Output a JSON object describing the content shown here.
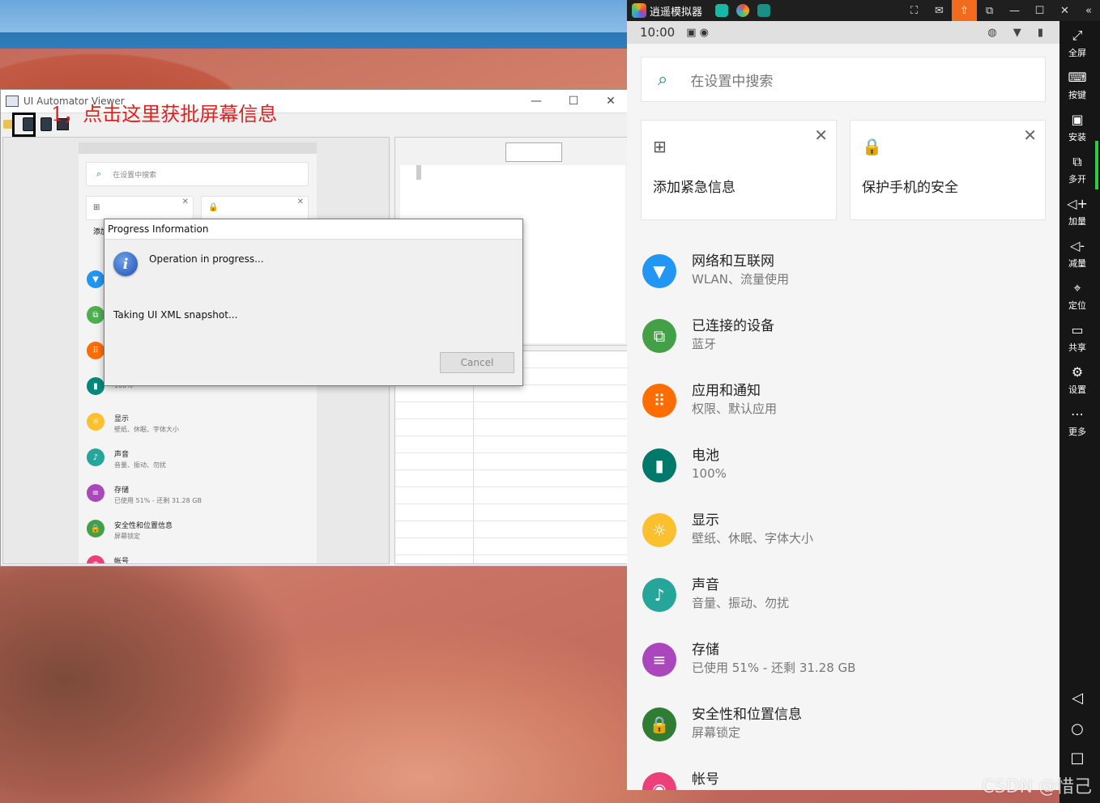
{
  "uiautomator": {
    "title": "UI Automator Viewer",
    "annotation": "1，点击这里获批屏幕信息",
    "win_min": "—",
    "win_max": "☐",
    "win_close": "✕",
    "mini": {
      "search_placeholder": "在设置中搜索",
      "card1_text": "添加",
      "items": [
        {
          "t1": "",
          "t2": "",
          "color": "#2196f3",
          "icon": "▼"
        },
        {
          "t1": "",
          "t2": "",
          "color": "#4caf50",
          "icon": "⧉"
        },
        {
          "t1": "",
          "t2": "",
          "color": "#ff6d00",
          "icon": "⠿"
        },
        {
          "t1": "",
          "t2": "100%",
          "color": "#00897b",
          "icon": "▮"
        },
        {
          "t1": "显示",
          "t2": "壁纸、休眠、字体大小",
          "color": "#fbc02d",
          "icon": "☼"
        },
        {
          "t1": "声音",
          "t2": "音量、振动、勿扰",
          "color": "#26a69a",
          "icon": "🔈"
        },
        {
          "t1": "存储",
          "t2": "已使用 51% - 还剩 31.28 GB",
          "color": "#ab47bc",
          "icon": "≡"
        },
        {
          "t1": "安全性和位置信息",
          "t2": "屏幕锁定",
          "color": "#43a047",
          "icon": "🔒"
        },
        {
          "t1": "帐号",
          "t2": "",
          "color": "#ec407a",
          "icon": "◉"
        }
      ]
    }
  },
  "dialog": {
    "title": "Progress Information",
    "message": "Operation in progress...",
    "status": "Taking UI XML snapshot...",
    "cancel_label": "Cancel",
    "info_glyph": "i"
  },
  "emulator": {
    "app_name": "逍遥模拟器",
    "status_time": "10:00",
    "status_icons": "◍ ▼ ▮",
    "search_placeholder": "在设置中搜索",
    "cards": [
      {
        "text": "添加紧急信息",
        "icon": "⊞",
        "close": "✕"
      },
      {
        "text": "保护手机的安全",
        "icon": "🔒",
        "close": "✕"
      }
    ],
    "items": [
      {
        "t1": "网络和互联网",
        "t2": "WLAN、流量使用",
        "color": "#2196f3",
        "icon": "▼"
      },
      {
        "t1": "已连接的设备",
        "t2": "蓝牙",
        "color": "#43a047",
        "icon": "⧉"
      },
      {
        "t1": "应用和通知",
        "t2": "权限、默认应用",
        "color": "#ff6d00",
        "icon": "⠿"
      },
      {
        "t1": "电池",
        "t2": "100%",
        "color": "#00796b",
        "icon": "▮"
      },
      {
        "t1": "显示",
        "t2": "壁纸、休眠、字体大小",
        "color": "#fbc02d",
        "icon": "☼"
      },
      {
        "t1": "声音",
        "t2": "音量、振动、勿扰",
        "color": "#26a69a",
        "icon": "🔈"
      },
      {
        "t1": "存储",
        "t2": "已使用 51% - 还剩 31.28 GB",
        "color": "#ab47bc",
        "icon": "≡"
      },
      {
        "t1": "安全性和位置信息",
        "t2": "屏幕锁定",
        "color": "#2e7d32",
        "icon": "🔒"
      },
      {
        "t1": "帐号",
        "t2": "",
        "color": "#ec407a",
        "icon": "◉"
      }
    ],
    "sidebar": [
      {
        "glyph": "⤢",
        "label": "全屏"
      },
      {
        "glyph": "⌨",
        "label": "按键"
      },
      {
        "glyph": "▣",
        "label": "安装"
      },
      {
        "glyph": "⧉",
        "label": "多开"
      },
      {
        "glyph": "◁+",
        "label": "加量"
      },
      {
        "glyph": "◁-",
        "label": "减量"
      },
      {
        "glyph": "⌖",
        "label": "定位"
      },
      {
        "glyph": "▭",
        "label": "共享"
      },
      {
        "glyph": "⚙",
        "label": "设置"
      },
      {
        "glyph": "⋯",
        "label": "更多"
      }
    ],
    "nav": {
      "back": "◁",
      "home": "○",
      "recents": "□"
    },
    "top_controls": [
      "⛶",
      "✉",
      "⇧",
      "⧉",
      "—",
      "☐",
      "✕"
    ],
    "collapse": "«"
  },
  "watermark": "CSDN @惜己"
}
